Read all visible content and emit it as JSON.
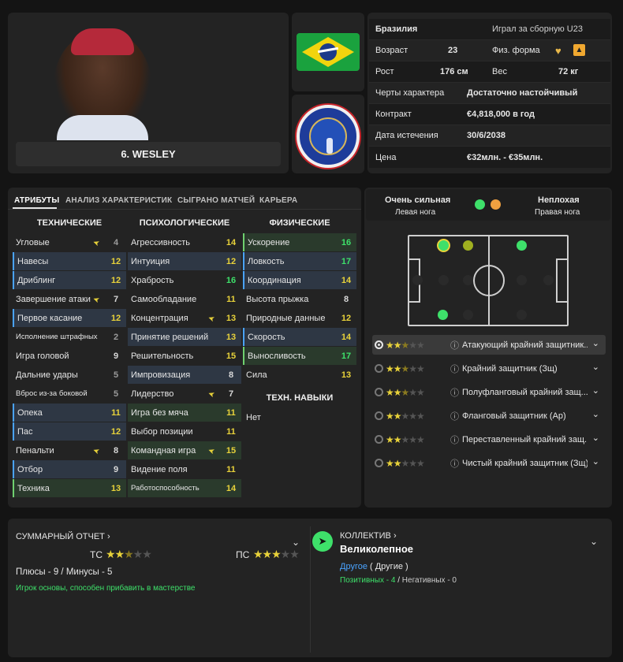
{
  "player": {
    "name": "6. WESLEY"
  },
  "info": {
    "nation": "Бразилия",
    "international": "Играл за сборную U23",
    "age_label": "Возраст",
    "age": "23",
    "fitness_label": "Физ. форма",
    "height_label": "Рост",
    "height": "176 см",
    "weight_label": "Вес",
    "weight": "72 кг",
    "personality_label": "Черты характера",
    "personality": "Достаточно настойчивый",
    "contract_label": "Контракт",
    "contract": "€4,818,000 в год",
    "expiry_label": "Дата истечения",
    "expiry": "30/6/2038",
    "value_label": "Цена",
    "value": "€32млн. - €35млн."
  },
  "tabs": [
    "АТРИБУТЫ",
    "АНАЛИЗ ХАРАКТЕРИСТИК",
    "СЫГРАНО МАТЧЕЙ",
    "КАРЬЕРА"
  ],
  "columns": {
    "technical": "ТЕХНИЧЕСКИЕ",
    "mental": "ПСИХОЛОГИЧЕСКИЕ",
    "physical": "ФИЗИЧЕСКИЕ",
    "skills": "ТЕХН. НАВЫКИ",
    "skills_value": "Нет"
  },
  "technical": [
    {
      "name": "Угловые",
      "value": "4"
    },
    {
      "name": "Навесы",
      "value": "12"
    },
    {
      "name": "Дриблинг",
      "value": "12"
    },
    {
      "name": "Завершение атаки",
      "value": "7"
    },
    {
      "name": "Первое касание",
      "value": "12"
    },
    {
      "name": "Исполнение штрафных",
      "value": "2"
    },
    {
      "name": "Игра головой",
      "value": "9"
    },
    {
      "name": "Дальние удары",
      "value": "5"
    },
    {
      "name": "Вброс из-за боковой",
      "value": "5"
    },
    {
      "name": "Опека",
      "value": "11"
    },
    {
      "name": "Пас",
      "value": "12"
    },
    {
      "name": "Пенальти",
      "value": "8"
    },
    {
      "name": "Отбор",
      "value": "9"
    },
    {
      "name": "Техника",
      "value": "13"
    }
  ],
  "mental": [
    {
      "name": "Агрессивность",
      "value": "14"
    },
    {
      "name": "Интуиция",
      "value": "12"
    },
    {
      "name": "Храбрость",
      "value": "16"
    },
    {
      "name": "Самообладание",
      "value": "11"
    },
    {
      "name": "Концентрация",
      "value": "13"
    },
    {
      "name": "Принятие решений",
      "value": "13"
    },
    {
      "name": "Решительность",
      "value": "15"
    },
    {
      "name": "Импровизация",
      "value": "8"
    },
    {
      "name": "Лидерство",
      "value": "7"
    },
    {
      "name": "Игра без мяча",
      "value": "11"
    },
    {
      "name": "Выбор позиции",
      "value": "11"
    },
    {
      "name": "Командная игра",
      "value": "15"
    },
    {
      "name": "Видение поля",
      "value": "11"
    },
    {
      "name": "Работоспособность",
      "value": "14"
    }
  ],
  "physical": [
    {
      "name": "Ускорение",
      "value": "16"
    },
    {
      "name": "Ловкость",
      "value": "17"
    },
    {
      "name": "Координация",
      "value": "14"
    },
    {
      "name": "Высота прыжка",
      "value": "8"
    },
    {
      "name": "Природные данные",
      "value": "12"
    },
    {
      "name": "Скорость",
      "value": "14"
    },
    {
      "name": "Выносливость",
      "value": "17"
    },
    {
      "name": "Сила",
      "value": "13"
    }
  ],
  "feet": {
    "left_grade": "Очень сильная",
    "left_label": "Левая нога",
    "right_grade": "Неплохая",
    "right_label": "Правая нога",
    "left_color": "#3ee06a",
    "right_color": "#f0a040"
  },
  "roles": [
    {
      "name": "Атакующий крайний защитник...",
      "stars": "2.5"
    },
    {
      "name": "Крайний защитник (Зщ)",
      "stars": "2.5"
    },
    {
      "name": "Полуфланговый крайний защ...",
      "stars": "2.5"
    },
    {
      "name": "Фланговый защитник (Ар)",
      "stars": "2"
    },
    {
      "name": "Переставленный крайний защ...",
      "stars": "2"
    },
    {
      "name": "Чистый крайний защитник (Зщ)",
      "stars": "2"
    }
  ],
  "report": {
    "title": "СУММАРНЫЙ ОТЧЕТ",
    "ca_label": "ТС",
    "pa_label": "ПС",
    "ca_stars": "2.5",
    "pa_stars": "3",
    "pros_cons": "Плюсы - 9 / Минусы - 5",
    "summary": "Игрок основы, способен прибавить в мастерстве"
  },
  "team": {
    "title": "КОЛЛЕКТИВ",
    "value": "Великолепное",
    "group": "Другое",
    "group_note": "( Другие )",
    "positive": "Позитивных - 4",
    "sep": "/",
    "negative": "Негативных - 0"
  },
  "icons": {
    "chevron": "chevron-down-icon",
    "arrow": "arrow-icon",
    "info": "info-icon"
  },
  "colors": {
    "accent": "#4aa3ff",
    "good": "#3ee06a",
    "star": "#e8d23a"
  }
}
